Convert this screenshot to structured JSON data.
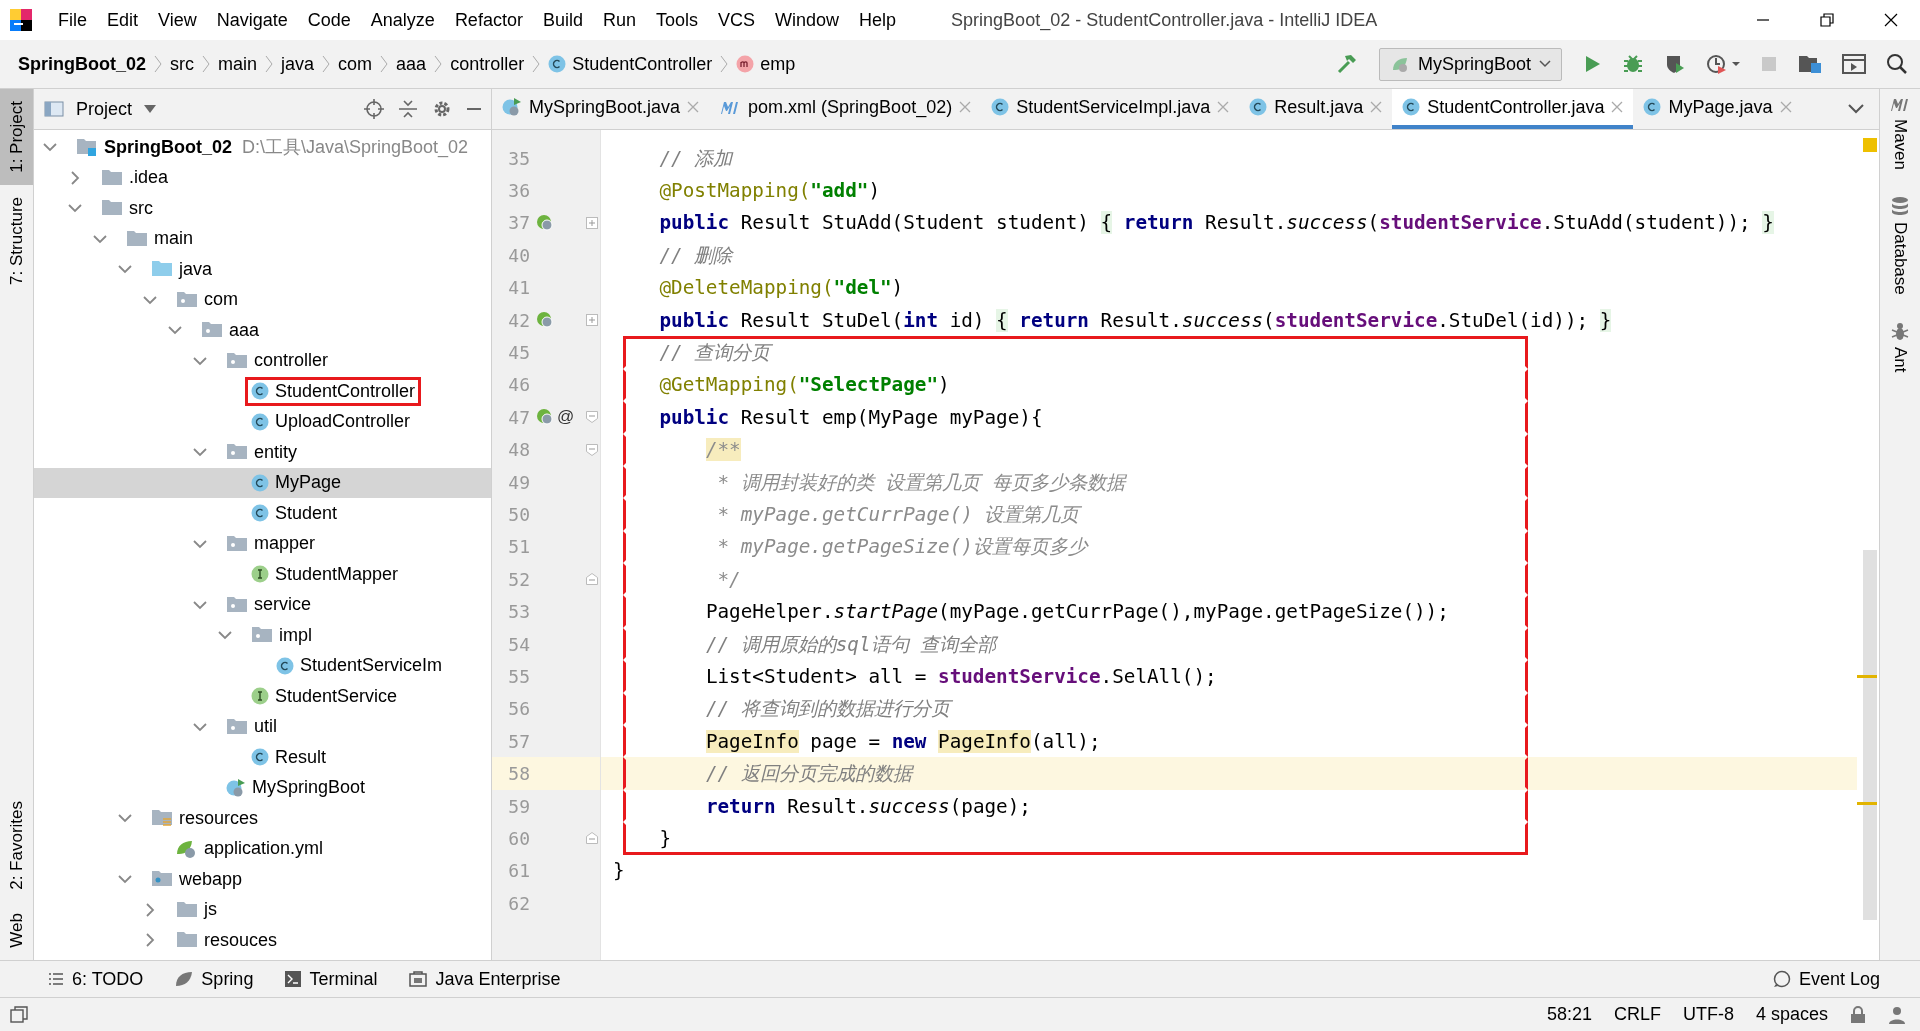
{
  "window": {
    "title": "SpringBoot_02 - StudentController.java - IntelliJ IDEA"
  },
  "menu": [
    "File",
    "Edit",
    "View",
    "Navigate",
    "Code",
    "Analyze",
    "Refactor",
    "Build",
    "Run",
    "Tools",
    "VCS",
    "Window",
    "Help"
  ],
  "breadcrumb": [
    {
      "label": "SpringBoot_02",
      "kind": "project"
    },
    {
      "label": "src",
      "kind": "folder"
    },
    {
      "label": "main",
      "kind": "folder"
    },
    {
      "label": "java",
      "kind": "folder"
    },
    {
      "label": "com",
      "kind": "folder"
    },
    {
      "label": "aaa",
      "kind": "folder"
    },
    {
      "label": "controller",
      "kind": "folder"
    },
    {
      "label": "StudentController",
      "kind": "class"
    },
    {
      "label": "emp",
      "kind": "method"
    }
  ],
  "run_config": "MySpringBoot",
  "left_tools": [
    {
      "label": "1: Project",
      "selected": true
    },
    {
      "label": "7: Structure",
      "selected": false
    },
    {
      "label": "2: Favorites",
      "selected": false
    },
    {
      "label": "Web",
      "selected": false
    }
  ],
  "right_tools": [
    {
      "label": "Maven",
      "kind": "maven"
    },
    {
      "label": "Database",
      "kind": "database"
    },
    {
      "label": "Ant",
      "kind": "ant"
    }
  ],
  "project": {
    "title": "Project",
    "tree": [
      {
        "name": "SpringBoot_02",
        "path": "D:\\工具\\Java\\SpringBoot_02",
        "kind": "module",
        "expanded": true,
        "selected": false,
        "boxed": false,
        "children": [
          {
            "name": ".idea",
            "kind": "folder",
            "expanded": false,
            "selected": false,
            "boxed": false
          },
          {
            "name": "src",
            "kind": "folder",
            "expanded": true,
            "selected": false,
            "boxed": false,
            "children": [
              {
                "name": "main",
                "kind": "folder",
                "expanded": true,
                "selected": false,
                "boxed": false,
                "children": [
                  {
                    "name": "java",
                    "kind": "source",
                    "expanded": true,
                    "selected": false,
                    "boxed": false,
                    "children": [
                      {
                        "name": "com",
                        "kind": "package",
                        "expanded": true,
                        "selected": false,
                        "boxed": false,
                        "children": [
                          {
                            "name": "aaa",
                            "kind": "package",
                            "expanded": true,
                            "selected": false,
                            "boxed": false,
                            "children": [
                              {
                                "name": "controller",
                                "kind": "package",
                                "expanded": true,
                                "selected": false,
                                "boxed": false,
                                "children": [
                                  {
                                    "name": "StudentController",
                                    "kind": "class",
                                    "selected": false,
                                    "boxed": true
                                  },
                                  {
                                    "name": "UploadController",
                                    "kind": "class",
                                    "selected": false,
                                    "boxed": false
                                  }
                                ]
                              },
                              {
                                "name": "entity",
                                "kind": "package",
                                "expanded": true,
                                "selected": false,
                                "boxed": false,
                                "children": [
                                  {
                                    "name": "MyPage",
                                    "kind": "class",
                                    "selected": true,
                                    "boxed": false
                                  },
                                  {
                                    "name": "Student",
                                    "kind": "class",
                                    "selected": false,
                                    "boxed": false
                                  }
                                ]
                              },
                              {
                                "name": "mapper",
                                "kind": "package",
                                "expanded": true,
                                "selected": false,
                                "boxed": false,
                                "children": [
                                  {
                                    "name": "StudentMapper",
                                    "kind": "interface",
                                    "selected": false,
                                    "boxed": false
                                  }
                                ]
                              },
                              {
                                "name": "service",
                                "kind": "package",
                                "expanded": true,
                                "selected": false,
                                "boxed": false,
                                "children": [
                                  {
                                    "name": "impl",
                                    "kind": "package",
                                    "expanded": true,
                                    "selected": false,
                                    "boxed": false,
                                    "children": [
                                      {
                                        "name": "StudentServiceIm",
                                        "kind": "class",
                                        "selected": false,
                                        "boxed": false
                                      }
                                    ]
                                  },
                                  {
                                    "name": "StudentService",
                                    "kind": "interface",
                                    "selected": false,
                                    "boxed": false
                                  }
                                ]
                              },
                              {
                                "name": "util",
                                "kind": "package",
                                "expanded": true,
                                "selected": false,
                                "boxed": false,
                                "children": [
                                  {
                                    "name": "Result",
                                    "kind": "class",
                                    "selected": false,
                                    "boxed": false
                                  }
                                ]
                              },
                              {
                                "name": "MySpringBoot",
                                "kind": "springboot",
                                "selected": false,
                                "boxed": false
                              }
                            ]
                          }
                        ]
                      }
                    ]
                  },
                  {
                    "name": "resources",
                    "kind": "resources",
                    "expanded": true,
                    "selected": false,
                    "boxed": false,
                    "children": [
                      {
                        "name": "application.yml",
                        "kind": "yml",
                        "selected": false,
                        "boxed": false
                      }
                    ]
                  },
                  {
                    "name": "webapp",
                    "kind": "web",
                    "expanded": true,
                    "selected": false,
                    "boxed": false,
                    "children": [
                      {
                        "name": "js",
                        "kind": "folder",
                        "expanded": false,
                        "selected": false,
                        "boxed": false
                      },
                      {
                        "name": "resouces",
                        "kind": "folder",
                        "expanded": false,
                        "selected": false,
                        "boxed": false
                      }
                    ]
                  }
                ]
              }
            ]
          }
        ]
      }
    ]
  },
  "tabs": [
    {
      "label": "MySpringBoot.java",
      "kind": "springboot",
      "selected": false
    },
    {
      "label": "pom.xml (SpringBoot_02)",
      "kind": "maven",
      "selected": false
    },
    {
      "label": "StudentServiceImpl.java",
      "kind": "class",
      "selected": false
    },
    {
      "label": "Result.java",
      "kind": "class",
      "selected": false
    },
    {
      "label": "StudentController.java",
      "kind": "class",
      "selected": true
    },
    {
      "label": "MyPage.java",
      "kind": "class",
      "selected": false
    }
  ],
  "editor": {
    "lines": [
      {
        "num": "35",
        "bean": false,
        "collapsed": false,
        "fold_start": false,
        "fold_end": false,
        "boxed": false,
        "current": false,
        "tokens": [
          {
            "t": "    // 添加",
            "kind": "comment"
          }
        ]
      },
      {
        "num": "36",
        "bean": false,
        "collapsed": false,
        "fold_start": false,
        "fold_end": false,
        "boxed": false,
        "current": false,
        "tokens": [
          {
            "t": "    @PostMapping(",
            "kind": "annotation"
          },
          {
            "t": "\"add\"",
            "kind": "string"
          },
          {
            "t": ")",
            "kind": "plain"
          }
        ]
      },
      {
        "num": "37",
        "bean": true,
        "collapsed": true,
        "fold_start": false,
        "fold_end": false,
        "boxed": false,
        "current": false,
        "tokens": [
          {
            "t": "    public",
            "kind": "keyword"
          },
          {
            "t": " Result StuAdd(Student student) ",
            "kind": "plain"
          },
          {
            "t": "{",
            "kind": "brace"
          },
          {
            "t": " return",
            "kind": "keyword"
          },
          {
            "t": " Result.",
            "kind": "plain"
          },
          {
            "t": "success",
            "kind": "static"
          },
          {
            "t": "(",
            "kind": "plain"
          },
          {
            "t": "studentService",
            "kind": "field"
          },
          {
            "t": ".StuAdd(student)); ",
            "kind": "plain"
          },
          {
            "t": "}",
            "kind": "brace"
          }
        ]
      },
      {
        "num": "40",
        "bean": false,
        "collapsed": false,
        "fold_start": false,
        "fold_end": false,
        "boxed": false,
        "current": false,
        "tokens": [
          {
            "t": "    // 删除",
            "kind": "comment"
          }
        ]
      },
      {
        "num": "41",
        "bean": false,
        "collapsed": false,
        "fold_start": false,
        "fold_end": false,
        "boxed": false,
        "current": false,
        "tokens": [
          {
            "t": "    @DeleteMapping(",
            "kind": "annotation"
          },
          {
            "t": "\"del\"",
            "kind": "string"
          },
          {
            "t": ")",
            "kind": "plain"
          }
        ]
      },
      {
        "num": "42",
        "bean": true,
        "collapsed": true,
        "fold_start": false,
        "fold_end": false,
        "boxed": false,
        "current": false,
        "tokens": [
          {
            "t": "    public",
            "kind": "keyword"
          },
          {
            "t": " Result StuDel(",
            "kind": "plain"
          },
          {
            "t": "int",
            "kind": "keyword"
          },
          {
            "t": " id) ",
            "kind": "plain"
          },
          {
            "t": "{",
            "kind": "brace"
          },
          {
            "t": " return",
            "kind": "keyword"
          },
          {
            "t": " Result.",
            "kind": "plain"
          },
          {
            "t": "success",
            "kind": "static"
          },
          {
            "t": "(",
            "kind": "plain"
          },
          {
            "t": "studentService",
            "kind": "field"
          },
          {
            "t": ".StuDel(id)); ",
            "kind": "plain"
          },
          {
            "t": "}",
            "kind": "brace"
          }
        ]
      },
      {
        "num": "45",
        "bean": false,
        "collapsed": false,
        "fold_start": false,
        "fold_end": false,
        "boxed": true,
        "current": false,
        "tokens": [
          {
            "t": "    // 查询分页",
            "kind": "comment"
          }
        ]
      },
      {
        "num": "46",
        "bean": false,
        "collapsed": false,
        "fold_start": false,
        "fold_end": false,
        "boxed": true,
        "current": false,
        "tokens": [
          {
            "t": "    @GetMapping(",
            "kind": "annotation"
          },
          {
            "t": "\"SelectPage\"",
            "kind": "string"
          },
          {
            "t": ")",
            "kind": "plain"
          }
        ]
      },
      {
        "num": "47",
        "bean": true,
        "at": "@",
        "collapsed": false,
        "fold_start": true,
        "fold_end": false,
        "boxed": true,
        "current": false,
        "tokens": [
          {
            "t": "    public",
            "kind": "keyword"
          },
          {
            "t": " Result emp(MyPage myPage){",
            "kind": "plain"
          }
        ]
      },
      {
        "num": "48",
        "bean": false,
        "collapsed": false,
        "fold_start": true,
        "fold_end": false,
        "boxed": true,
        "current": false,
        "tokens": [
          {
            "t": "        /**",
            "kind": "doc-usage"
          }
        ]
      },
      {
        "num": "49",
        "bean": false,
        "collapsed": false,
        "fold_start": false,
        "fold_end": false,
        "boxed": true,
        "current": false,
        "tokens": [
          {
            "t": "         * 调用封装好的类 设置第几页 每页多少条数据",
            "kind": "doc"
          }
        ]
      },
      {
        "num": "50",
        "bean": false,
        "collapsed": false,
        "fold_start": false,
        "fold_end": false,
        "boxed": true,
        "current": false,
        "tokens": [
          {
            "t": "         * myPage.getCurrPage() 设置第几页",
            "kind": "doc"
          }
        ]
      },
      {
        "num": "51",
        "bean": false,
        "collapsed": false,
        "fold_start": false,
        "fold_end": false,
        "boxed": true,
        "current": false,
        "tokens": [
          {
            "t": "         * myPage.getPageSize()设置每页多少",
            "kind": "doc"
          }
        ]
      },
      {
        "num": "52",
        "bean": false,
        "collapsed": false,
        "fold_start": false,
        "fold_end": true,
        "boxed": true,
        "current": false,
        "tokens": [
          {
            "t": "         */",
            "kind": "doc"
          }
        ]
      },
      {
        "num": "53",
        "bean": false,
        "collapsed": false,
        "fold_start": false,
        "fold_end": false,
        "boxed": true,
        "current": false,
        "tokens": [
          {
            "t": "        PageHelper.",
            "kind": "plain"
          },
          {
            "t": "startPage",
            "kind": "static"
          },
          {
            "t": "(myPage.getCurrPage(),myPage.getPageSize());",
            "kind": "plain"
          }
        ]
      },
      {
        "num": "54",
        "bean": false,
        "collapsed": false,
        "fold_start": false,
        "fold_end": false,
        "boxed": true,
        "current": false,
        "tokens": [
          {
            "t": "        // 调用原始的sql语句 查询全部",
            "kind": "comment"
          }
        ]
      },
      {
        "num": "55",
        "bean": false,
        "collapsed": false,
        "fold_start": false,
        "fold_end": false,
        "boxed": true,
        "current": false,
        "tokens": [
          {
            "t": "        List<Student> all = ",
            "kind": "plain"
          },
          {
            "t": "studentService",
            "kind": "field"
          },
          {
            "t": ".SelAll();",
            "kind": "plain"
          }
        ]
      },
      {
        "num": "56",
        "bean": false,
        "collapsed": false,
        "fold_start": false,
        "fold_end": false,
        "boxed": true,
        "current": false,
        "tokens": [
          {
            "t": "        // 将查询到的数据进行分页",
            "kind": "comment"
          }
        ]
      },
      {
        "num": "57",
        "bean": false,
        "collapsed": false,
        "fold_start": false,
        "fold_end": false,
        "boxed": true,
        "current": false,
        "tokens": [
          {
            "t": "        PageInfo",
            "kind": "usage"
          },
          {
            "t": " page = ",
            "kind": "plain"
          },
          {
            "t": "new ",
            "kind": "keyword"
          },
          {
            "t": "PageInfo",
            "kind": "usage"
          },
          {
            "t": "(all);",
            "kind": "plain"
          }
        ]
      },
      {
        "num": "58",
        "bean": false,
        "collapsed": false,
        "fold_start": false,
        "fold_end": false,
        "boxed": true,
        "current": true,
        "tokens": [
          {
            "t": "        // 返回分页完成的数据",
            "kind": "comment"
          }
        ]
      },
      {
        "num": "59",
        "bean": false,
        "collapsed": false,
        "fold_start": false,
        "fold_end": false,
        "boxed": true,
        "current": false,
        "tokens": [
          {
            "t": "        return",
            "kind": "keyword"
          },
          {
            "t": " Result.",
            "kind": "plain"
          },
          {
            "t": "success",
            "kind": "static"
          },
          {
            "t": "(page);",
            "kind": "plain"
          }
        ]
      },
      {
        "num": "60",
        "bean": false,
        "collapsed": false,
        "fold_start": false,
        "fold_end": true,
        "boxed": true,
        "current": false,
        "tokens": [
          {
            "t": "    }",
            "kind": "plain"
          }
        ]
      },
      {
        "num": "61",
        "bean": false,
        "collapsed": false,
        "fold_start": false,
        "fold_end": false,
        "boxed": false,
        "current": false,
        "tokens": [
          {
            "t": "}",
            "kind": "plain"
          }
        ]
      },
      {
        "num": "62",
        "bean": false,
        "collapsed": false,
        "fold_start": false,
        "fold_end": false,
        "boxed": false,
        "current": false
      }
    ]
  },
  "bottom_tools": [
    {
      "label": "6: TODO",
      "kind": "todo"
    },
    {
      "label": "Spring",
      "kind": "spring"
    },
    {
      "label": "Terminal",
      "kind": "terminal"
    },
    {
      "label": "Java Enterprise",
      "kind": "enterprise"
    }
  ],
  "event_log": "Event Log",
  "status_bar": [
    "58:21",
    "CRLF",
    "UTF-8",
    "4 spaces"
  ]
}
